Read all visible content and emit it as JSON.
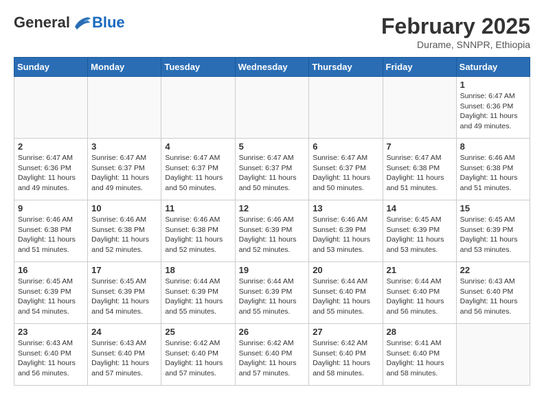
{
  "header": {
    "logo_general": "General",
    "logo_blue": "Blue",
    "month_year": "February 2025",
    "location": "Durame, SNNPR, Ethiopia"
  },
  "days_of_week": [
    "Sunday",
    "Monday",
    "Tuesday",
    "Wednesday",
    "Thursday",
    "Friday",
    "Saturday"
  ],
  "weeks": [
    {
      "days": [
        {
          "num": "",
          "info": ""
        },
        {
          "num": "",
          "info": ""
        },
        {
          "num": "",
          "info": ""
        },
        {
          "num": "",
          "info": ""
        },
        {
          "num": "",
          "info": ""
        },
        {
          "num": "",
          "info": ""
        },
        {
          "num": "1",
          "info": "Sunrise: 6:47 AM\nSunset: 6:36 PM\nDaylight: 11 hours\nand 49 minutes."
        }
      ]
    },
    {
      "days": [
        {
          "num": "2",
          "info": "Sunrise: 6:47 AM\nSunset: 6:36 PM\nDaylight: 11 hours\nand 49 minutes."
        },
        {
          "num": "3",
          "info": "Sunrise: 6:47 AM\nSunset: 6:37 PM\nDaylight: 11 hours\nand 49 minutes."
        },
        {
          "num": "4",
          "info": "Sunrise: 6:47 AM\nSunset: 6:37 PM\nDaylight: 11 hours\nand 50 minutes."
        },
        {
          "num": "5",
          "info": "Sunrise: 6:47 AM\nSunset: 6:37 PM\nDaylight: 11 hours\nand 50 minutes."
        },
        {
          "num": "6",
          "info": "Sunrise: 6:47 AM\nSunset: 6:37 PM\nDaylight: 11 hours\nand 50 minutes."
        },
        {
          "num": "7",
          "info": "Sunrise: 6:47 AM\nSunset: 6:38 PM\nDaylight: 11 hours\nand 51 minutes."
        },
        {
          "num": "8",
          "info": "Sunrise: 6:46 AM\nSunset: 6:38 PM\nDaylight: 11 hours\nand 51 minutes."
        }
      ]
    },
    {
      "days": [
        {
          "num": "9",
          "info": "Sunrise: 6:46 AM\nSunset: 6:38 PM\nDaylight: 11 hours\nand 51 minutes."
        },
        {
          "num": "10",
          "info": "Sunrise: 6:46 AM\nSunset: 6:38 PM\nDaylight: 11 hours\nand 52 minutes."
        },
        {
          "num": "11",
          "info": "Sunrise: 6:46 AM\nSunset: 6:38 PM\nDaylight: 11 hours\nand 52 minutes."
        },
        {
          "num": "12",
          "info": "Sunrise: 6:46 AM\nSunset: 6:39 PM\nDaylight: 11 hours\nand 52 minutes."
        },
        {
          "num": "13",
          "info": "Sunrise: 6:46 AM\nSunset: 6:39 PM\nDaylight: 11 hours\nand 53 minutes."
        },
        {
          "num": "14",
          "info": "Sunrise: 6:45 AM\nSunset: 6:39 PM\nDaylight: 11 hours\nand 53 minutes."
        },
        {
          "num": "15",
          "info": "Sunrise: 6:45 AM\nSunset: 6:39 PM\nDaylight: 11 hours\nand 53 minutes."
        }
      ]
    },
    {
      "days": [
        {
          "num": "16",
          "info": "Sunrise: 6:45 AM\nSunset: 6:39 PM\nDaylight: 11 hours\nand 54 minutes."
        },
        {
          "num": "17",
          "info": "Sunrise: 6:45 AM\nSunset: 6:39 PM\nDaylight: 11 hours\nand 54 minutes."
        },
        {
          "num": "18",
          "info": "Sunrise: 6:44 AM\nSunset: 6:39 PM\nDaylight: 11 hours\nand 55 minutes."
        },
        {
          "num": "19",
          "info": "Sunrise: 6:44 AM\nSunset: 6:39 PM\nDaylight: 11 hours\nand 55 minutes."
        },
        {
          "num": "20",
          "info": "Sunrise: 6:44 AM\nSunset: 6:40 PM\nDaylight: 11 hours\nand 55 minutes."
        },
        {
          "num": "21",
          "info": "Sunrise: 6:44 AM\nSunset: 6:40 PM\nDaylight: 11 hours\nand 56 minutes."
        },
        {
          "num": "22",
          "info": "Sunrise: 6:43 AM\nSunset: 6:40 PM\nDaylight: 11 hours\nand 56 minutes."
        }
      ]
    },
    {
      "days": [
        {
          "num": "23",
          "info": "Sunrise: 6:43 AM\nSunset: 6:40 PM\nDaylight: 11 hours\nand 56 minutes."
        },
        {
          "num": "24",
          "info": "Sunrise: 6:43 AM\nSunset: 6:40 PM\nDaylight: 11 hours\nand 57 minutes."
        },
        {
          "num": "25",
          "info": "Sunrise: 6:42 AM\nSunset: 6:40 PM\nDaylight: 11 hours\nand 57 minutes."
        },
        {
          "num": "26",
          "info": "Sunrise: 6:42 AM\nSunset: 6:40 PM\nDaylight: 11 hours\nand 57 minutes."
        },
        {
          "num": "27",
          "info": "Sunrise: 6:42 AM\nSunset: 6:40 PM\nDaylight: 11 hours\nand 58 minutes."
        },
        {
          "num": "28",
          "info": "Sunrise: 6:41 AM\nSunset: 6:40 PM\nDaylight: 11 hours\nand 58 minutes."
        },
        {
          "num": "",
          "info": ""
        }
      ]
    }
  ]
}
